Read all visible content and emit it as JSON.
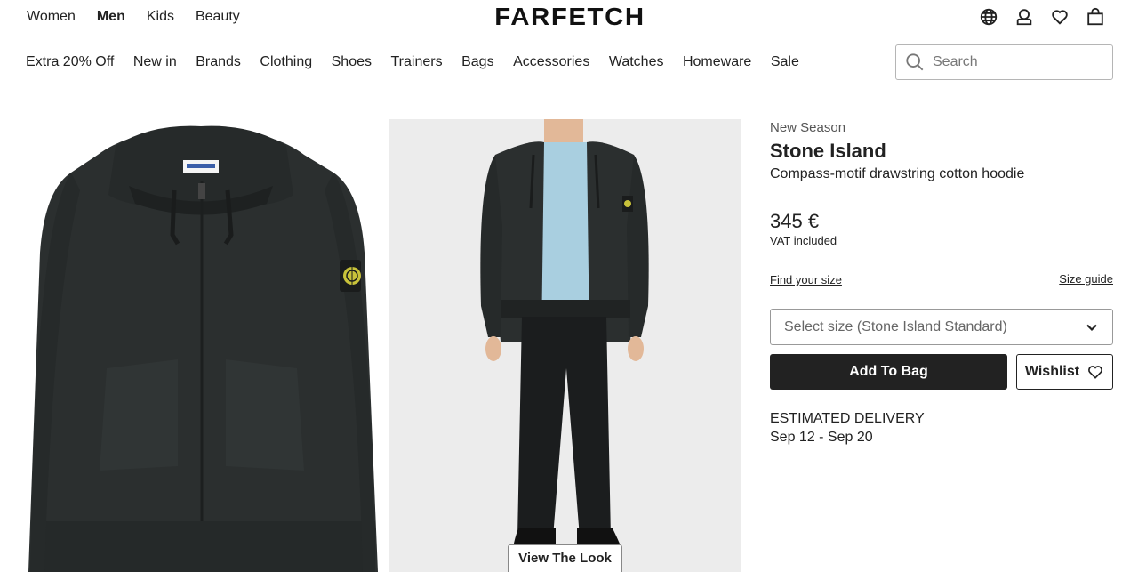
{
  "header": {
    "departments": [
      {
        "label": "Women",
        "active": false
      },
      {
        "label": "Men",
        "active": true
      },
      {
        "label": "Kids",
        "active": false
      },
      {
        "label": "Beauty",
        "active": false
      }
    ],
    "logo": "FARFETCH",
    "utility_icons": [
      "globe-icon",
      "account-icon",
      "heart-icon",
      "bag-icon"
    ]
  },
  "category_nav": [
    "Extra 20% Off",
    "New in",
    "Brands",
    "Clothing",
    "Shoes",
    "Trainers",
    "Bags",
    "Accessories",
    "Watches",
    "Homeware",
    "Sale"
  ],
  "search": {
    "placeholder": "Search"
  },
  "gallery": {
    "images": [
      "hoodie-front-image",
      "model-wearing-hoodie-image"
    ],
    "view_look_label": "View The Look"
  },
  "product": {
    "season": "New Season",
    "brand": "Stone Island",
    "description": "Compass-motif drawstring cotton hoodie",
    "price": "345 €",
    "vat_note": "VAT included",
    "find_size_label": "Find your size",
    "size_guide_label": "Size guide",
    "size_select_placeholder": "Select size (Stone Island Standard)",
    "add_to_bag_label": "Add To Bag",
    "wishlist_label": "Wishlist",
    "delivery_label": "ESTIMATED DELIVERY",
    "delivery_dates": "Sep 12 - Sep 20"
  },
  "colors": {
    "primary_button": "#222222",
    "hoodie": "#2b2f2f",
    "shirt": "#a9cfe0",
    "image_bg": "#ececec"
  }
}
